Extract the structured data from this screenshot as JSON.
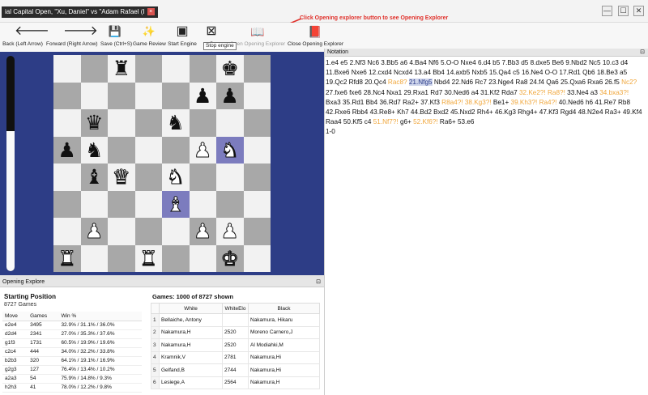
{
  "window": {
    "tab_title": "ial Capital Open, \"Xu, Daniel\" vs \"Adam Rafael (I",
    "tab_close": "×",
    "minimize": "—",
    "maximize": "☐",
    "close": "✕"
  },
  "annotation": "Click Opening explorer button to see Opening Explorer",
  "toolbar": [
    {
      "id": "back",
      "label": "Back (Left Arrow)",
      "icon": "arrow-left-icon",
      "glyph": "🡐"
    },
    {
      "id": "forward",
      "label": "Forward (Right Arrow)",
      "icon": "arrow-right-icon",
      "glyph": "🡒"
    },
    {
      "id": "save",
      "label": "Save (Ctrl+S)",
      "icon": "save-icon",
      "glyph": "💾"
    },
    {
      "id": "review",
      "label": "Game Review",
      "icon": "sparkle-icon",
      "glyph": "✨"
    },
    {
      "id": "start-engine",
      "label": "Start Engine",
      "icon": "chip-icon",
      "glyph": "▣"
    },
    {
      "id": "stop-engine",
      "label": "S",
      "icon": "chip-off-icon",
      "glyph": "⊠"
    },
    {
      "id": "open-explorer",
      "label": "Open Opening Explorer",
      "icon": "book-icon",
      "glyph": "📖"
    },
    {
      "id": "close-explorer",
      "label": "Close Opening Explorer",
      "icon": "book-off-icon",
      "glyph": "📕"
    }
  ],
  "tooltip": "Stop engine",
  "colors": {
    "board_bg": "#2d3d86",
    "light_square": "#f2f2f2",
    "dark_square": "#a8a8a8",
    "dubious_move": "#f0a63a"
  },
  "eval_white_fraction": 0.65,
  "board": {
    "ranks": [
      [
        " ",
        " ",
        "r",
        " ",
        " ",
        " ",
        "k",
        " "
      ],
      [
        " ",
        " ",
        " ",
        " ",
        " ",
        "p",
        "p",
        " "
      ],
      [
        " ",
        "q",
        " ",
        " ",
        "n",
        " ",
        " ",
        " "
      ],
      [
        "p",
        "n",
        " ",
        " ",
        " ",
        "P",
        "N",
        " "
      ],
      [
        " ",
        "b",
        "Q",
        " ",
        "N",
        " ",
        " ",
        " "
      ],
      [
        " ",
        " ",
        " ",
        " ",
        "B",
        " ",
        " ",
        " "
      ],
      [
        " ",
        "P",
        " ",
        " ",
        " ",
        "P",
        "P",
        " "
      ],
      [
        "R",
        " ",
        " ",
        "R",
        " ",
        " ",
        "K",
        " "
      ]
    ],
    "highlights": [
      "e3",
      "g5"
    ]
  },
  "notation": {
    "header": "Notation",
    "moves": [
      {
        "t": "1.e4 e5 2.Nf3 Nc6 3.Bb5 a6 4.Ba4 Nf6 5.O-O Nxe4 6.d4 b5 7.Bb3 d5 8.dxe5 Be6 9.Nbd2 Nc5 10.c3 d4 11.Bxe6 Nxe6 12.cxd4 Ncxd4 13.a4 Bb4 14.axb5 Nxb5 15.Qa4 c5 16.Ne4 O-O 17.Rd1 Qb6 18.Be3 a5 19.Qc2 Rfd8 20.Qc4 ",
        "k": "n"
      },
      {
        "t": "Rac8?",
        "k": "d"
      },
      {
        "t": " ",
        "k": "n"
      },
      {
        "t": "21.Nfg5",
        "k": "c"
      },
      {
        "t": " Nbd4 22.Nd6 Rc7 23.Nge4 Ra8 24.f4 Qa6 25.Qxa6 Rxa6 26.f5 ",
        "k": "n"
      },
      {
        "t": "Nc2?",
        "k": "d"
      },
      {
        "t": " 27.fxe6 fxe6 28.Nc4 Nxa1 29.Rxa1 Rd7 30.Ned6 a4 31.Kf2 Rda7 ",
        "k": "n"
      },
      {
        "t": "32.Ke2?! Ra8?!",
        "k": "d"
      },
      {
        "t": " 33.Ne4 a3 ",
        "k": "n"
      },
      {
        "t": "34.bxa3?!",
        "k": "d"
      },
      {
        "t": " Bxa3 35.Rd1 Bb4 36.Rd7 Ra2+ 37.Kf3 ",
        "k": "n"
      },
      {
        "t": "R8a4?! 38.Kg3?!",
        "k": "d"
      },
      {
        "t": " Be1+ ",
        "k": "n"
      },
      {
        "t": "39.Kh3?! Ra4?!",
        "k": "d"
      },
      {
        "t": " 40.Ned6 h6 41.Re7 Rb8 42.Rxe6 Rbb4 43.Re8+ Kh7 44.Bd2 Bxd2 45.Nxd2 Rh4+ 46.Kg3 Rhg4+ 47.Kf3 Rgd4 48.N2e4 Ra3+ 49.Kf4 Raa4 50.Kf5 c4 ",
        "k": "n"
      },
      {
        "t": "51.Nf7?!",
        "k": "d"
      },
      {
        "t": " g6+ ",
        "k": "n"
      },
      {
        "t": "52.Kf6?!",
        "k": "d"
      },
      {
        "t": " Ra6+ 53.e6",
        "k": "n"
      }
    ],
    "result": "1-0"
  },
  "explorer": {
    "header": "Opening Explore",
    "title": "Starting Position",
    "count": "8727 Games",
    "columns": [
      "Move",
      "Games",
      "Win %"
    ],
    "rows": [
      [
        "e2e4",
        "3495",
        "32.9% / 31.1% / 36.0%"
      ],
      [
        "d2d4",
        "2341",
        "27.0% / 35.3% / 37.6%"
      ],
      [
        "g1f3",
        "1731",
        "60.5% / 19.9% / 19.6%"
      ],
      [
        "c2c4",
        "444",
        "34.0% / 32.2% / 33.8%"
      ],
      [
        "b2b3",
        "320",
        "64.1% / 19.1% / 16.9%"
      ],
      [
        "g2g3",
        "127",
        "76.4% / 13.4% / 10.2%"
      ],
      [
        "a2a3",
        "54",
        "75.9% / 14.8% / 9.3%"
      ],
      [
        "h2h3",
        "41",
        "78.0% / 12.2% / 9.8%"
      ]
    ],
    "games_title": "Games: 1000 of 8727 shown",
    "game_columns": [
      "",
      "White",
      "WhiteElo",
      "Black"
    ],
    "games": [
      [
        "1",
        "Bellaiche, Antony",
        "",
        "Nakamura, Hikaru"
      ],
      [
        "2",
        "Nakamura,H",
        "2520",
        "Moreno Carnero,J"
      ],
      [
        "3",
        "Nakamura,H",
        "2520",
        "Al Modiahki,M"
      ],
      [
        "4",
        "Kramnik,V",
        "2781",
        "Nakamura,Hi"
      ],
      [
        "5",
        "Gelfand,B",
        "2744",
        "Nakamura,Hi"
      ],
      [
        "6",
        "Lesiege,A",
        "2564",
        "Nakamura,H"
      ]
    ]
  }
}
